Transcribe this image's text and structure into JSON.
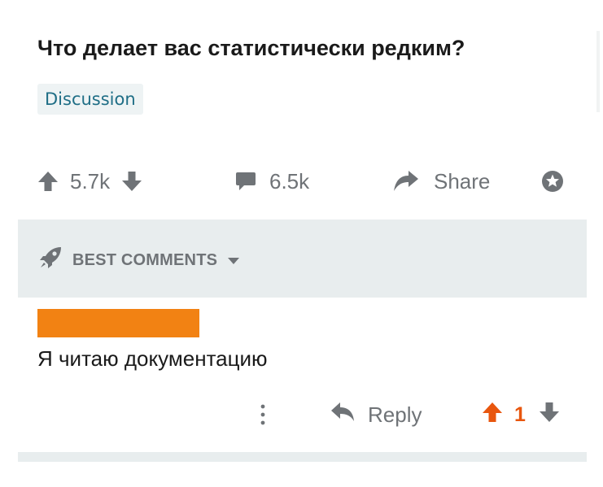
{
  "post": {
    "title": "Что делает вас статистически редким?",
    "flair": "Discussion",
    "vote_count": "5.7k",
    "comment_count": "6.5k",
    "share_label": "Share"
  },
  "sort": {
    "label": "BEST COMMENTS"
  },
  "comment": {
    "text": "Я читаю документацию",
    "reply_label": "Reply",
    "score": "1"
  },
  "colors": {
    "icon_gray": "#6f7377",
    "upvote_active": "#e8560e",
    "redaction": "#f28213",
    "flair_bg": "#eef3f4",
    "flair_text": "#1f6e86",
    "sort_bar_bg": "#e8edee"
  },
  "icons": {
    "upvote": "arrow-up-icon",
    "downvote": "arrow-down-icon",
    "comments": "speech-bubble-icon",
    "share": "share-arrow-icon",
    "award": "award-star-icon",
    "sort": "rocket-icon",
    "caret": "caret-down-icon",
    "more": "vertical-dots-icon",
    "reply": "reply-arrow-icon"
  }
}
